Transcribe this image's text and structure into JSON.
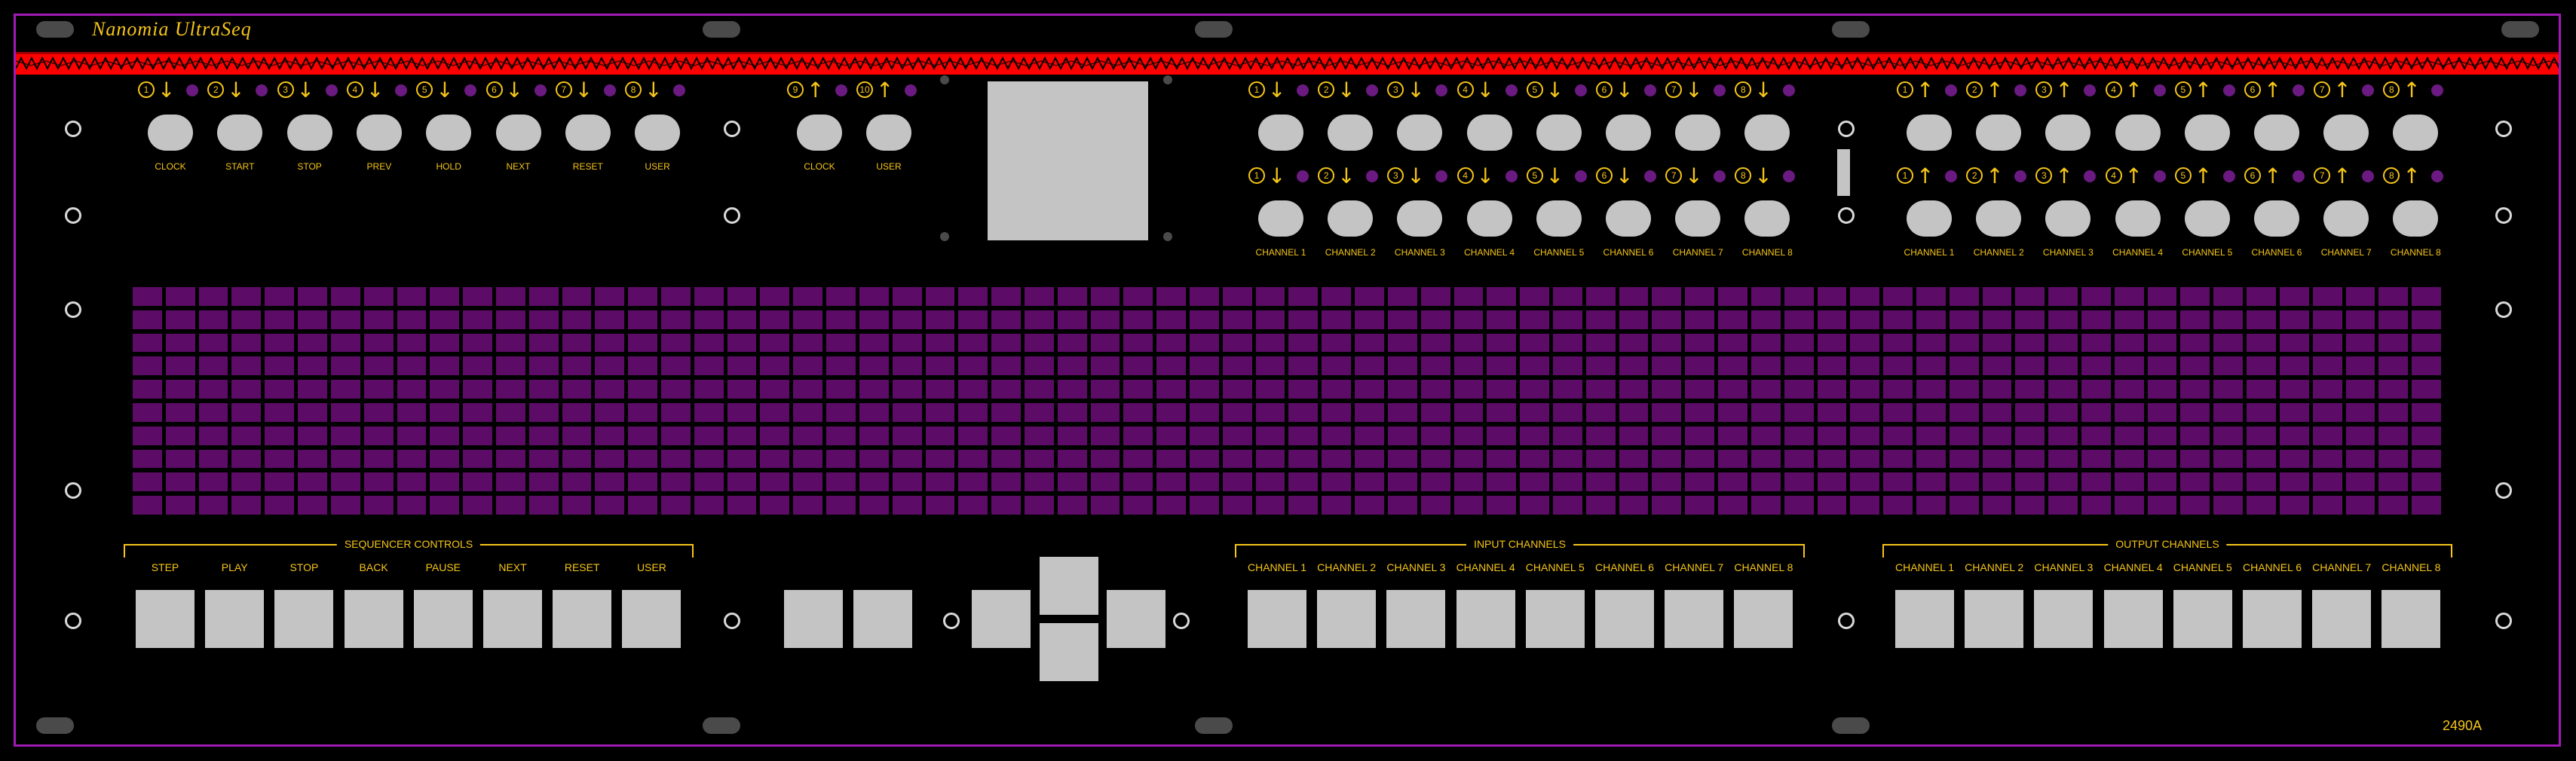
{
  "brand": "Nanomia UltraSeq",
  "model": "2490A",
  "colors": {
    "accent": "#f5c518",
    "led": "#6a1a80",
    "grid": "#5c0c66",
    "stripe": "#ff0000",
    "frame": "#a01ab4",
    "control": "#c4c4c4"
  },
  "top_inputs": {
    "jacks": [
      {
        "num": "1",
        "arrow": "↓",
        "label": "CLOCK"
      },
      {
        "num": "2",
        "arrow": "↓",
        "label": "START"
      },
      {
        "num": "3",
        "arrow": "↓",
        "label": "STOP"
      },
      {
        "num": "4",
        "arrow": "↓",
        "label": "PREV"
      },
      {
        "num": "5",
        "arrow": "↓",
        "label": "HOLD"
      },
      {
        "num": "6",
        "arrow": "↓",
        "label": "NEXT"
      },
      {
        "num": "7",
        "arrow": "↓",
        "label": "RESET"
      },
      {
        "num": "8",
        "arrow": "↓",
        "label": "USER"
      }
    ]
  },
  "top_outputs": {
    "jacks": [
      {
        "num": "9",
        "arrow": "↑",
        "label": "CLOCK"
      },
      {
        "num": "10",
        "arrow": "↑",
        "label": "USER"
      }
    ]
  },
  "cv_upper_left": [
    "1",
    "2",
    "3",
    "4",
    "5",
    "6",
    "7",
    "8"
  ],
  "cv_lower_left": [
    "1",
    "2",
    "3",
    "4",
    "5",
    "6",
    "7",
    "8"
  ],
  "cv_upper_right": [
    "1",
    "2",
    "3",
    "4",
    "5",
    "6",
    "7",
    "8"
  ],
  "cv_lower_right": [
    "1",
    "2",
    "3",
    "4",
    "5",
    "6",
    "7",
    "8"
  ],
  "arrows": {
    "down": "↓",
    "up": "↑"
  },
  "channel_labels": [
    "CHANNEL 1",
    "CHANNEL 2",
    "CHANNEL 3",
    "CHANNEL 4",
    "CHANNEL 5",
    "CHANNEL 6",
    "CHANNEL 7",
    "CHANNEL 8"
  ],
  "sequencer": {
    "title": "SEQUENCER CONTROLS",
    "buttons": [
      "STEP",
      "PLAY",
      "STOP",
      "BACK",
      "PAUSE",
      "NEXT",
      "RESET",
      "USER"
    ]
  },
  "input_channels": {
    "title": "INPUT CHANNELS",
    "buttons": [
      "CHANNEL 1",
      "CHANNEL 2",
      "CHANNEL 3",
      "CHANNEL 4",
      "CHANNEL 5",
      "CHANNEL 6",
      "CHANNEL 7",
      "CHANNEL 8"
    ]
  },
  "output_channels": {
    "title": "OUTPUT CHANNELS",
    "buttons": [
      "CHANNEL 1",
      "CHANNEL 2",
      "CHANNEL 3",
      "CHANNEL 4",
      "CHANNEL 5",
      "CHANNEL 6",
      "CHANNEL 7",
      "CHANNEL 8"
    ]
  },
  "led_grid": {
    "columns": 70,
    "rows": 10
  }
}
